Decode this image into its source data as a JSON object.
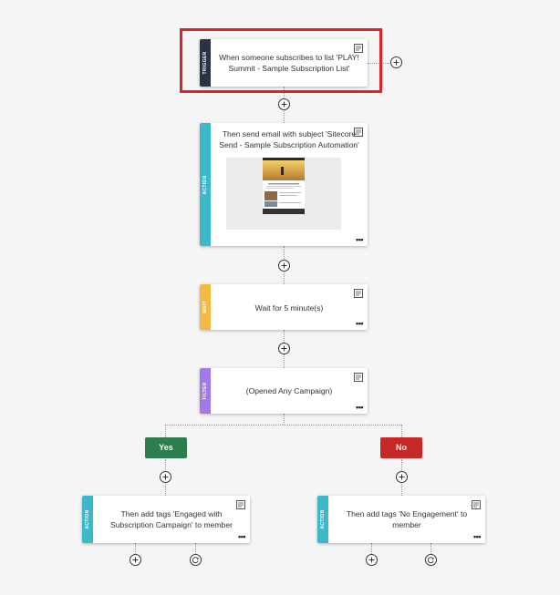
{
  "trigger": {
    "label": "TRIGGER",
    "text": "When someone subscribes to list 'PLAY! Summit - Sample Subscription List'"
  },
  "action_email": {
    "label": "ACTION",
    "text": "Then send email with subject 'Sitecore Send - Sample Subscription Automation'"
  },
  "wait": {
    "label": "WAIT",
    "text": "Wait for 5 minute(s)"
  },
  "filter": {
    "label": "FILTER",
    "text": "(Opened Any Campaign)"
  },
  "branches": {
    "yes_label": "Yes",
    "no_label": "No"
  },
  "action_yes": {
    "label": "ACTION",
    "text": "Then add tags 'Engaged with Subscription Campaign' to member"
  },
  "action_no": {
    "label": "ACTION",
    "text": "Then add tags 'No Engagement' to member"
  },
  "colors": {
    "trigger": "#2a3346",
    "action": "#3cb8c9",
    "wait": "#f2b945",
    "filter": "#a279e6",
    "yes": "#2e7d4f",
    "no": "#c62828",
    "highlight": "#d9252b"
  },
  "icons": {
    "note": "note-icon",
    "more": "more-options-icon",
    "add": "add-step-icon",
    "loop": "loop-icon"
  }
}
